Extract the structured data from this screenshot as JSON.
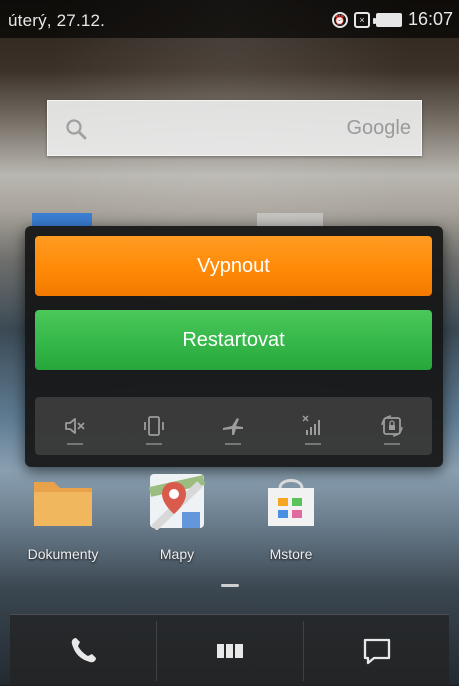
{
  "status_bar": {
    "date": "úterý, 27.12.",
    "time": "16:07",
    "icons": [
      "alarm-icon",
      "notification-icon",
      "battery-icon"
    ]
  },
  "search_bar": {
    "placeholder": "Google",
    "icon": "search-icon"
  },
  "power_menu": {
    "power_off_label": "Vypnout",
    "restart_label": "Restartovat",
    "toggles": [
      {
        "name": "silent-mode-icon"
      },
      {
        "name": "vibrate-icon"
      },
      {
        "name": "airplane-mode-icon"
      },
      {
        "name": "mobile-data-icon"
      },
      {
        "name": "screen-lock-icon"
      }
    ],
    "colors": {
      "power_off": "#ff8a06",
      "restart": "#35b749"
    }
  },
  "home_apps": [
    {
      "label": "Dokumenty",
      "icon": "folder-icon"
    },
    {
      "label": "Mapy",
      "icon": "maps-icon"
    },
    {
      "label": "Mstore",
      "icon": "store-icon"
    }
  ],
  "dock": [
    {
      "name": "phone-icon"
    },
    {
      "name": "app-drawer-icon"
    },
    {
      "name": "messages-icon"
    }
  ]
}
